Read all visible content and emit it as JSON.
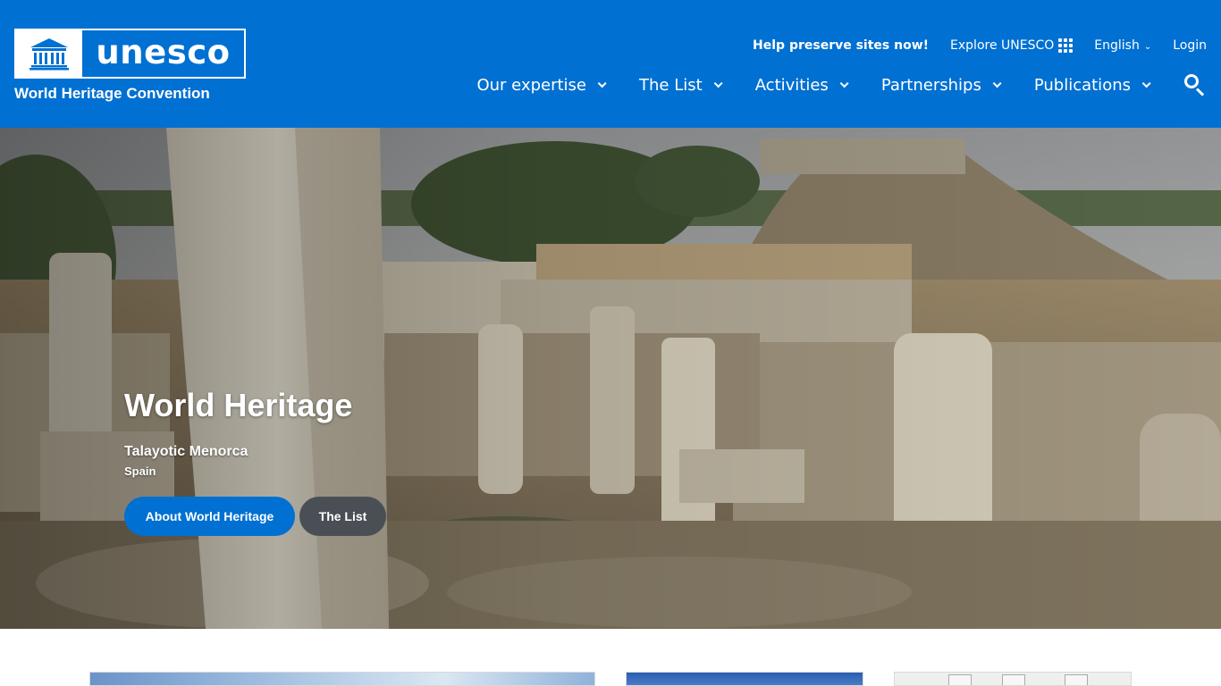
{
  "brand": {
    "logo_word": "unesco",
    "logo_subtitle": "World Heritage Convention",
    "color_primary": "#0070d2"
  },
  "utility_nav": {
    "help_link": "Help preserve sites now!",
    "explore": "Explore UNESCO",
    "explore_icon": "apps-grid-icon",
    "language": "English",
    "login": "Login"
  },
  "main_nav": {
    "items": [
      {
        "label": "Our expertise"
      },
      {
        "label": "The List"
      },
      {
        "label": "Activities"
      },
      {
        "label": "Partnerships"
      },
      {
        "label": "Publications"
      }
    ],
    "search_icon": "search-icon"
  },
  "hero": {
    "title": "World Heritage",
    "site_name": "Talayotic Menorca",
    "country": "Spain",
    "primary_button": "About World Heritage",
    "secondary_button": "The List"
  }
}
